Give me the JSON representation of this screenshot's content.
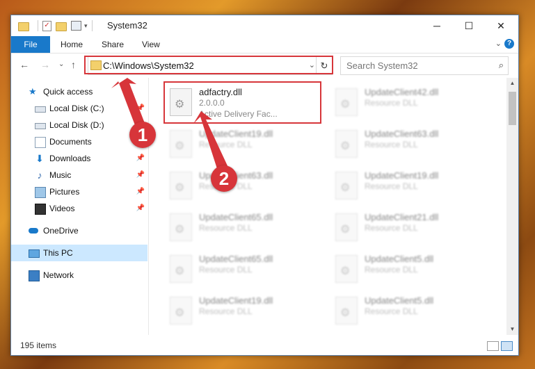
{
  "window": {
    "title": "System32",
    "quick_access_toolbar": [
      "folder-icon",
      "properties-check-icon",
      "new-folder-icon",
      "customize-icon"
    ],
    "controls": {
      "minimize": "─",
      "maximize": "☐",
      "close": "✕"
    }
  },
  "ribbon": {
    "tabs": [
      {
        "label": "File",
        "active": true
      },
      {
        "label": "Home"
      },
      {
        "label": "Share"
      },
      {
        "label": "View"
      }
    ],
    "expand_glyph": "⌄",
    "help_glyph": "?"
  },
  "navigation": {
    "back": "←",
    "forward": "→",
    "recent": "⌄",
    "up": "↑",
    "address": "C:\\Windows\\System32",
    "refresh": "↻",
    "search_placeholder": "Search System32",
    "search_icon": "⌕"
  },
  "sidebar": {
    "items": [
      {
        "label": "Quick access",
        "icon": "star-icon",
        "pinned": false
      },
      {
        "label": "Local Disk (C:)",
        "icon": "drive-icon",
        "pinned": true
      },
      {
        "label": "Local Disk (D:)",
        "icon": "drive-icon",
        "pinned": false
      },
      {
        "label": "Documents",
        "icon": "documents-icon",
        "pinned": true
      },
      {
        "label": "Downloads",
        "icon": "downloads-icon",
        "pinned": true
      },
      {
        "label": "Music",
        "icon": "music-icon",
        "pinned": true
      },
      {
        "label": "Pictures",
        "icon": "pictures-icon",
        "pinned": true
      },
      {
        "label": "Videos",
        "icon": "videos-icon",
        "pinned": true
      },
      {
        "label": "OneDrive",
        "icon": "onedrive-icon",
        "pinned": false
      },
      {
        "label": "This PC",
        "icon": "this-pc-icon",
        "pinned": false,
        "selected": true
      },
      {
        "label": "Network",
        "icon": "network-icon",
        "pinned": false
      }
    ],
    "pin_glyph": "📌"
  },
  "files": {
    "highlighted": {
      "name": "adfactry.dll",
      "version": "2.0.0.0",
      "description": "Active Delivery Fac..."
    },
    "left_column": [
      {
        "name": "UpdateClient19.dll",
        "type": "Resource DLL"
      },
      {
        "name": "UpdateClient63.dll",
        "type": "Resource DLL"
      },
      {
        "name": "UpdateClient65.dll",
        "type": "Resource DLL"
      },
      {
        "name": "UpdateClient65.dll",
        "type": "Resource DLL"
      },
      {
        "name": "UpdateClient19.dll",
        "type": "Resource DLL"
      }
    ],
    "right_column": [
      {
        "name": "UpdateClient42.dll",
        "type": "Resource DLL"
      },
      {
        "name": "UpdateClient63.dll",
        "type": "Resource DLL"
      },
      {
        "name": "UpdateClient19.dll",
        "type": "Resource DLL"
      },
      {
        "name": "UpdateClient21.dll",
        "type": "Resource DLL"
      },
      {
        "name": "UpdateClient5.dll",
        "type": "Resource DLL"
      },
      {
        "name": "UpdateClient5.dll",
        "type": "Resource DLL"
      }
    ]
  },
  "status": {
    "item_count": "195 items"
  },
  "annotations": {
    "step1": "1",
    "step2": "2",
    "color": "#d7353a"
  }
}
